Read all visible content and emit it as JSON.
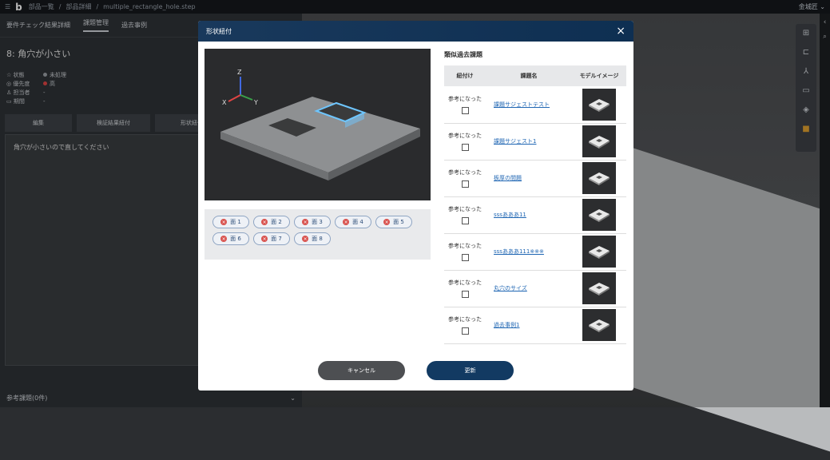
{
  "topbar": {
    "logo": "b",
    "crumb1": "部品一覧",
    "crumb2": "部品詳細",
    "crumb3": "multiple_rectangle_hole.step",
    "user": "金城匠"
  },
  "left": {
    "tabs": [
      "要件チェック結果詳細",
      "課題管理",
      "過去事例"
    ],
    "title": "8: 角穴が小さい",
    "props": [
      {
        "key": "状態",
        "value": "未処理",
        "color": "#9aa0a6"
      },
      {
        "key": "優先度",
        "value": "高",
        "color": "#e04444"
      },
      {
        "key": "担当者",
        "value": "-",
        "color": ""
      },
      {
        "key": "期間",
        "value": "-",
        "color": ""
      }
    ],
    "actions": [
      "編集",
      "検証結果紐付",
      "形状紐付"
    ],
    "comment": "角穴が小さいので直してください",
    "ref_label": "参考課題(0件)"
  },
  "modal": {
    "title": "形状紐付",
    "similar_title": "類似過去課題",
    "columns": [
      "紐付け",
      "課題名",
      "モデルイメージ"
    ],
    "faces": [
      "面 1",
      "面 2",
      "面 3",
      "面 4",
      "面 5",
      "面 6",
      "面 7",
      "面 8"
    ],
    "row_label": "参考になった",
    "rows": [
      {
        "name": "課題サジェストテスト"
      },
      {
        "name": "課題サジェスト1"
      },
      {
        "name": "板厚の間題"
      },
      {
        "name": "sssあああ11"
      },
      {
        "name": "sssあああ111※※※"
      },
      {
        "name": "丸穴のサイズ"
      },
      {
        "name": "過去事例1"
      }
    ],
    "cancel": "キャンセル",
    "update": "更新"
  }
}
